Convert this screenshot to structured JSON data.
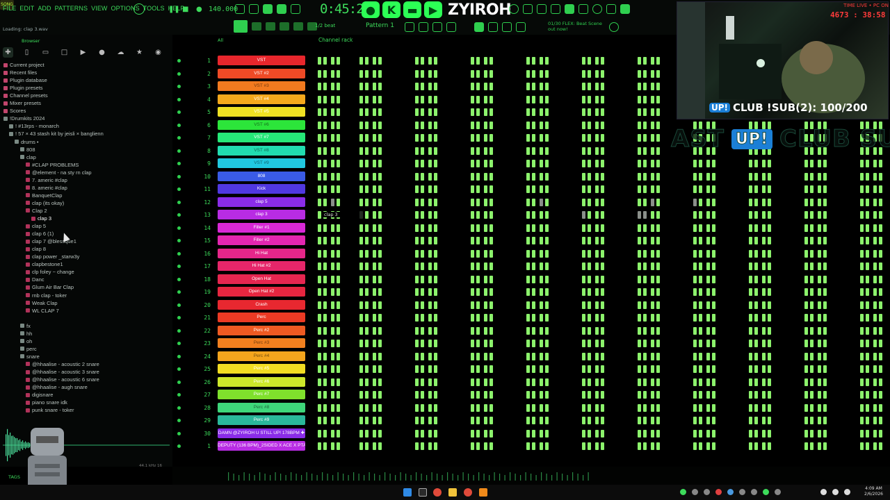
{
  "menu": [
    "FILE",
    "EDIT",
    "ADD",
    "PATTERNS",
    "VIEW",
    "OPTIONS",
    "TOOLS",
    "HELP"
  ],
  "transport": {
    "song_label": "SONG",
    "tempo": "140.000",
    "time": "0:45:29",
    "snap": "1/2 beat",
    "pattern": "Pattern 1",
    "hint": "01/30 FLEX: Beat Scene out now!"
  },
  "logo": {
    "text": "ZYIROH"
  },
  "browser": {
    "loading": "Loading: clap 3.wav",
    "title": "Browser",
    "rows": [
      {
        "label": "Current project",
        "indent": 0,
        "type": "special"
      },
      {
        "label": "Recent files",
        "indent": 0,
        "type": "special"
      },
      {
        "label": "Plugin database",
        "indent": 0,
        "type": "special"
      },
      {
        "label": "Plugin presets",
        "indent": 0,
        "type": "special"
      },
      {
        "label": "Channel presets",
        "indent": 0,
        "type": "special"
      },
      {
        "label": "Mixer presets",
        "indent": 0,
        "type": "special"
      },
      {
        "label": "Scores",
        "indent": 0,
        "type": "special"
      },
      {
        "label": "!Drumkits 2024",
        "indent": 0,
        "type": "folder"
      },
      {
        "label": "! #13rps - monarch",
        "indent": 1,
        "type": "folder"
      },
      {
        "label": "! 57 × 43 stash kit by jeisli × banglienn",
        "indent": 1,
        "type": "folder"
      },
      {
        "label": "drums •",
        "indent": 2,
        "type": "folder"
      },
      {
        "label": "808",
        "indent": 3,
        "type": "folder"
      },
      {
        "label": "clap",
        "indent": 3,
        "type": "folder"
      },
      {
        "label": "#CLAP PROBLEMS",
        "indent": 4,
        "type": "wav"
      },
      {
        "label": "@element - na sty rn clap",
        "indent": 4,
        "type": "wav"
      },
      {
        "label": "7. americ #clap",
        "indent": 4,
        "type": "wav"
      },
      {
        "label": "8. americ #clap",
        "indent": 4,
        "type": "wav"
      },
      {
        "label": "BanquetClap",
        "indent": 4,
        "type": "wav"
      },
      {
        "label": "clap (its okay)",
        "indent": 4,
        "type": "wav"
      },
      {
        "label": "Clap 2",
        "indent": 4,
        "type": "wav"
      },
      {
        "label": "clap 3",
        "indent": 5,
        "type": "wav",
        "selected": true
      },
      {
        "label": "clap 5",
        "indent": 4,
        "type": "wav"
      },
      {
        "label": "clap 6 (1)",
        "indent": 4,
        "type": "wav"
      },
      {
        "label": "clap 7 @blessque1",
        "indent": 4,
        "type": "wav"
      },
      {
        "label": "clap 8",
        "indent": 4,
        "type": "wav"
      },
      {
        "label": "clap power _starw3y",
        "indent": 4,
        "type": "wav"
      },
      {
        "label": "clapbestone1",
        "indent": 4,
        "type": "wav"
      },
      {
        "label": "clp foley ~ change",
        "indent": 4,
        "type": "wav"
      },
      {
        "label": "Danc",
        "indent": 4,
        "type": "wav"
      },
      {
        "label": "Glum Air Bar Clap",
        "indent": 4,
        "type": "wav"
      },
      {
        "label": "rnb clap - toker",
        "indent": 4,
        "type": "wav"
      },
      {
        "label": "Weak Clap",
        "indent": 4,
        "type": "wav"
      },
      {
        "label": "WL CLAP 7",
        "indent": 4,
        "type": "wav"
      },
      {
        "label": "",
        "indent": 3,
        "type": "none"
      },
      {
        "label": "fx",
        "indent": 3,
        "type": "folder"
      },
      {
        "label": "hh",
        "indent": 3,
        "type": "folder"
      },
      {
        "label": "oh",
        "indent": 3,
        "type": "folder"
      },
      {
        "label": "perc",
        "indent": 3,
        "type": "folder"
      },
      {
        "label": "snare",
        "indent": 3,
        "type": "folder"
      },
      {
        "label": "@hhaalise - acoustic 2 snare",
        "indent": 4,
        "type": "wav"
      },
      {
        "label": "@hhaalise - acoustic 3 snare",
        "indent": 4,
        "type": "wav"
      },
      {
        "label": "@hhaalise - acoustic 6 snare",
        "indent": 4,
        "type": "wav"
      },
      {
        "label": "@hhaalise - augh snare",
        "indent": 4,
        "type": "wav"
      },
      {
        "label": "digisnare",
        "indent": 4,
        "type": "wav"
      },
      {
        "label": "piano snare idk",
        "indent": 4,
        "type": "wav"
      },
      {
        "label": "punk snare - toker",
        "indent": 4,
        "type": "wav"
      }
    ],
    "sample_rate": "44.1 kHz 16",
    "tags_label": "TAGS"
  },
  "rack": {
    "title": "Channel rack",
    "filter": "All",
    "clap3_tag": "clap 3",
    "channels": [
      {
        "num": "1",
        "name": "VST",
        "color": "#e8262c",
        "dark": false,
        "pattern": "normal"
      },
      {
        "num": "2",
        "name": "VST #2",
        "color": "#ef4a26",
        "dark": false,
        "pattern": "normal"
      },
      {
        "num": "3",
        "name": "VST #3",
        "color": "#f27a1f",
        "dark": true,
        "pattern": "normal"
      },
      {
        "num": "4",
        "name": "VST #4",
        "color": "#f5a91c",
        "dark": false,
        "pattern": "normal"
      },
      {
        "num": "5",
        "name": "VST #5",
        "color": "#efe123",
        "dark": false,
        "pattern": "normal"
      },
      {
        "num": "6",
        "name": "VST #6",
        "color": "#2ce53a",
        "dark": true,
        "pattern": "normal"
      },
      {
        "num": "7",
        "name": "VST #7",
        "color": "#26e878",
        "dark": false,
        "pattern": "normal"
      },
      {
        "num": "8",
        "name": "VST #8",
        "color": "#21dcb0",
        "dark": true,
        "pattern": "normal"
      },
      {
        "num": "9",
        "name": "VST #9",
        "color": "#21c8e0",
        "dark": true,
        "pattern": "normal"
      },
      {
        "num": "10",
        "name": "808",
        "color": "#3a5be6",
        "dark": false,
        "pattern": "normal"
      },
      {
        "num": "11",
        "name": "Kick",
        "color": "#5038e0",
        "dark": false,
        "pattern": "normal"
      },
      {
        "num": "12",
        "name": "clap 5",
        "color": "#8a2ce8",
        "dark": false,
        "pattern": "clap5"
      },
      {
        "num": "13",
        "name": "clap 3",
        "color": "#b82ce3",
        "dark": false,
        "pattern": "clap3"
      },
      {
        "num": "14",
        "name": "Filler #1",
        "color": "#d828d6",
        "dark": false,
        "pattern": "normal"
      },
      {
        "num": "15",
        "name": "Filler #2",
        "color": "#e326b0",
        "dark": false,
        "pattern": "normal"
      },
      {
        "num": "16",
        "name": "Hi Hat",
        "color": "#e6268a",
        "dark": false,
        "pattern": "normal"
      },
      {
        "num": "17",
        "name": "Hi Hat #2",
        "color": "#e6266a",
        "dark": false,
        "pattern": "normal"
      },
      {
        "num": "18",
        "name": "Open Hat",
        "color": "#e62650",
        "dark": false,
        "pattern": "normal"
      },
      {
        "num": "19",
        "name": "Open Hat #2",
        "color": "#e62640",
        "dark": false,
        "pattern": "normal"
      },
      {
        "num": "20",
        "name": "Crash",
        "color": "#e82830",
        "dark": false,
        "pattern": "normal"
      },
      {
        "num": "21",
        "name": "Perc",
        "color": "#ec3a24",
        "dark": false,
        "pattern": "normal"
      },
      {
        "num": "22",
        "name": "Perc #2",
        "color": "#ef5a22",
        "dark": false,
        "pattern": "normal"
      },
      {
        "num": "23",
        "name": "Perc #3",
        "color": "#f2801f",
        "dark": true,
        "pattern": "normal"
      },
      {
        "num": "24",
        "name": "Perc #4",
        "color": "#f4a51d",
        "dark": true,
        "pattern": "normal"
      },
      {
        "num": "25",
        "name": "Perc #5",
        "color": "#f2dd22",
        "dark": false,
        "pattern": "normal"
      },
      {
        "num": "26",
        "name": "Perc #6",
        "color": "#cde82a",
        "dark": false,
        "pattern": "normal"
      },
      {
        "num": "27",
        "name": "Perc #7",
        "color": "#7fe02c",
        "dark": false,
        "pattern": "normal"
      },
      {
        "num": "28",
        "name": "Perc #8",
        "color": "#3ed67a",
        "dark": true,
        "pattern": "normal"
      },
      {
        "num": "29",
        "name": "Perc #9",
        "color": "#2ab79a",
        "dark": false,
        "pattern": "normal"
      },
      {
        "num": "30",
        "name": "DAMN @ZYIROH U STILL UP! 178BPM ✚",
        "color": "#8a2ce8",
        "dark": false,
        "pattern": "normal"
      },
      {
        "num": "1",
        "name": "DEPUTY (136 BPM)_2SIDED X ACE X PTA ✚",
        "color": "#b82ce3",
        "dark": false,
        "pattern": "normal"
      }
    ]
  },
  "overlay": {
    "stream_info": "TIME LIVE • PC ON",
    "counter": "4673 : 38:58",
    "sub_text": "CLUB !SUB(2): 100/200",
    "up_badge": "UP!",
    "marquee_left": "AST",
    "marquee_right": "CLUB SU"
  },
  "clock": {
    "time": "4:09 AM",
    "date": "2/6/2026"
  }
}
